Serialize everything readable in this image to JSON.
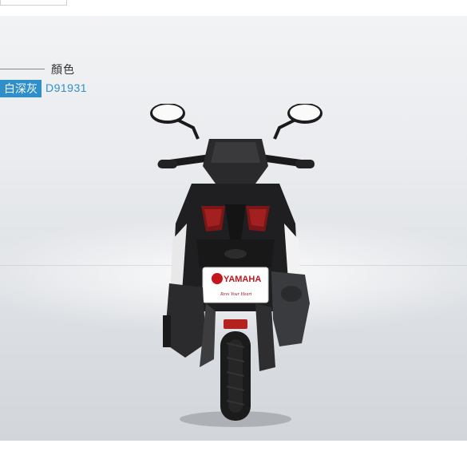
{
  "header": {
    "label": "顏色"
  },
  "color": {
    "name": "白深灰",
    "code": "D91931"
  },
  "product": {
    "plate_brand": "YAMAHA",
    "plate_slogan": "Revs Your Heart"
  },
  "colors": {
    "accent": "#2e8fcb"
  }
}
